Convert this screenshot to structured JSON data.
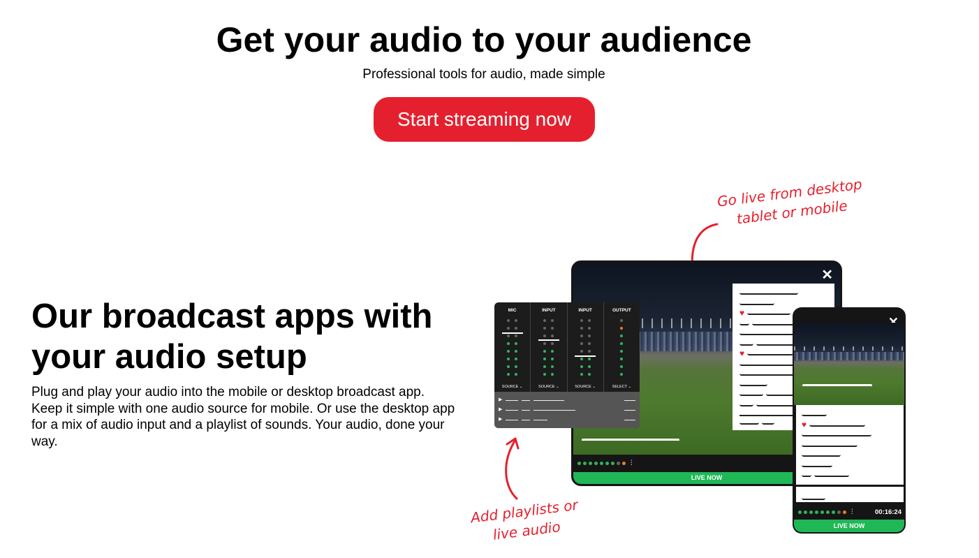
{
  "hero": {
    "title": "Get your audio to your audience",
    "subtitle": "Professional tools for audio, made simple",
    "cta_label": "Start streaming now"
  },
  "section": {
    "title": "Our broadcast apps with your audio setup",
    "body": "Plug and play your audio into the mobile or desktop broadcast app. Keep it simple with one audio source for mobile. Or use the desktop app for a mix of audio input and a playlist of sounds. Your audio, done your way."
  },
  "annotations": {
    "top": "Go live from desktop tablet or mobile",
    "bottom": "Add playlists or live audio"
  },
  "mixer": {
    "columns": [
      {
        "label": "MIC",
        "source": "SOURCE ⌄"
      },
      {
        "label": "INPUT",
        "source": "SOURCE ⌄"
      },
      {
        "label": "INPUT",
        "source": "SOURCE ⌄"
      },
      {
        "label": "OUTPUT",
        "source": "SELECT ⌄"
      }
    ]
  },
  "tablet": {
    "close_glyph": "✕",
    "live_label": "LIVE NOW"
  },
  "phone": {
    "close_glyph": "✕",
    "timer": "00:16:24",
    "live_label": "LIVE NOW"
  },
  "colors": {
    "accent": "#e5202e",
    "live_green": "#20b857",
    "meter_green": "#2db55d",
    "meter_orange": "#f07a1c"
  },
  "icons": {
    "close": "close-icon",
    "heart": "heart-icon",
    "play": "play-icon",
    "equalizer": "equalizer-icon",
    "arrow": "curved-arrow-icon"
  }
}
